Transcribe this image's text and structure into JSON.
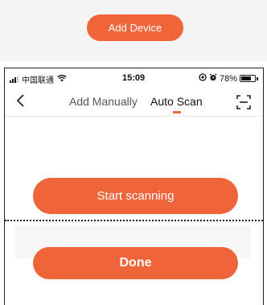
{
  "top_panel": {
    "add_device_label": "Add Device"
  },
  "status_bar": {
    "carrier": "中国联通",
    "time": "15:09",
    "battery_percent": "78%",
    "battery_level": 0.78,
    "icons": [
      "signal-icon",
      "wifi-icon",
      "location-lock-icon",
      "alarm-icon",
      "battery-icon"
    ]
  },
  "nav": {
    "tabs": [
      {
        "label": "Add Manually",
        "active": false
      },
      {
        "label": "Auto Scan",
        "active": true
      }
    ],
    "icons": [
      "back-icon",
      "scan-icon"
    ]
  },
  "actions": {
    "start_label": "Start scanning",
    "done_label": "Done"
  },
  "colors": {
    "accent": "#ef6439"
  }
}
